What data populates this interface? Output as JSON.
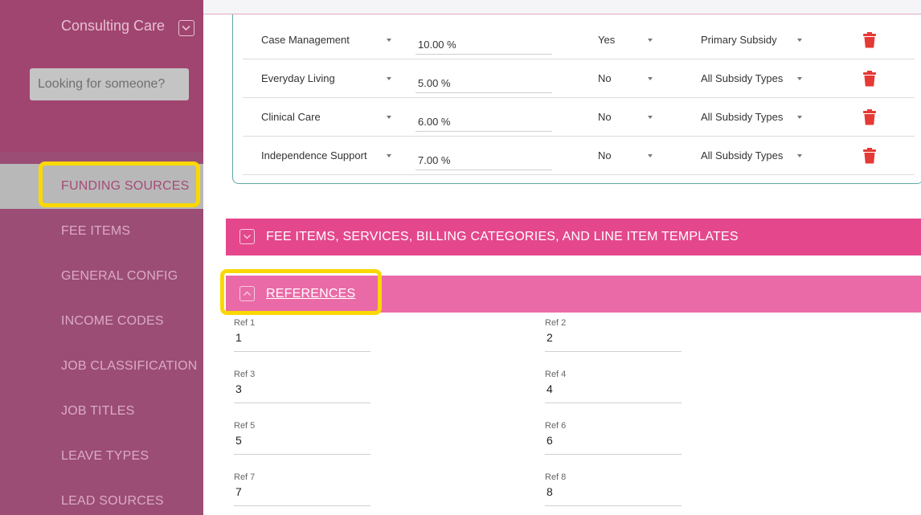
{
  "sidebar": {
    "org_name": "Consulting Care",
    "search_placeholder": "Looking for someone?",
    "items": [
      {
        "label": "FUNDING SOURCES"
      },
      {
        "label": "FEE ITEMS"
      },
      {
        "label": "GENERAL CONFIG"
      },
      {
        "label": "INCOME CODES"
      },
      {
        "label": "JOB CLASSIFICATION"
      },
      {
        "label": "JOB TITLES"
      },
      {
        "label": "LEAVE TYPES"
      },
      {
        "label": "LEAD SOURCES"
      }
    ]
  },
  "funding_table": {
    "rows": [
      {
        "category": "Case Management",
        "percent": "10.00 %",
        "flag": "Yes",
        "subsidy": "Primary Subsidy"
      },
      {
        "category": "Everyday Living",
        "percent": "5.00 %",
        "flag": "No",
        "subsidy": "All Subsidy Types"
      },
      {
        "category": "Clinical Care",
        "percent": "6.00 %",
        "flag": "No",
        "subsidy": "All Subsidy Types"
      },
      {
        "category": "Independence Support",
        "percent": "7.00 %",
        "flag": "No",
        "subsidy": "All Subsidy Types"
      }
    ]
  },
  "sections": {
    "fee_items": "FEE ITEMS, SERVICES, BILLING CATEGORIES, AND LINE ITEM TEMPLATES",
    "references": "REFERENCES"
  },
  "references": [
    {
      "label": "Ref 1",
      "value": "1"
    },
    {
      "label": "Ref 2",
      "value": "2"
    },
    {
      "label": "Ref 3",
      "value": "3"
    },
    {
      "label": "Ref 4",
      "value": "4"
    },
    {
      "label": "Ref 5",
      "value": "5"
    },
    {
      "label": "Ref 6",
      "value": "6"
    },
    {
      "label": "Ref 7",
      "value": "7"
    },
    {
      "label": "Ref 8",
      "value": "8"
    }
  ],
  "colors": {
    "sidebar": "#9b4d76",
    "active_item_bg": "#b8b8b8",
    "highlight": "#fbd800",
    "fee_section": "#e4478c",
    "references_section": "#ea6aa7",
    "trash": "#e53935",
    "card_border": "#5fa8a4"
  },
  "icons": {
    "org_toggle": "chevron-down-icon",
    "row_delete": "trash-icon",
    "fee_toggle": "chevron-down-icon",
    "references_toggle": "chevron-up-icon"
  }
}
